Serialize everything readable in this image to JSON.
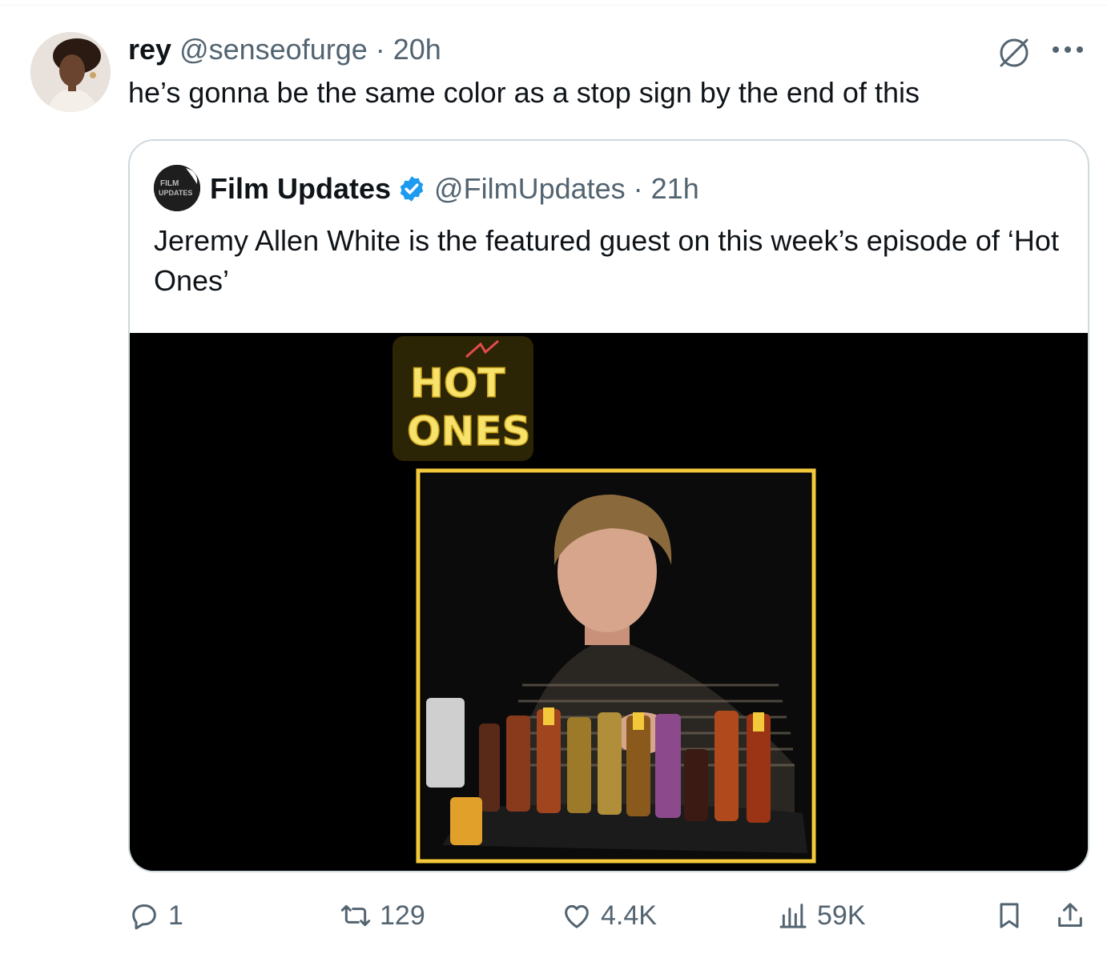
{
  "tweet": {
    "display_name": "rey",
    "handle": "@senseofurge",
    "separator": "·",
    "time": "20h",
    "text": "he’s gonna be the same color as a stop sign by the end of this",
    "avatar_icon": "user-avatar",
    "header_icons": [
      "no-entry-icon",
      "more-options-icon"
    ]
  },
  "quoted": {
    "display_name": "Film Updates",
    "handle": "@FilmUpdates",
    "separator": "·",
    "time": "21h",
    "text": "Jeremy Allen White is the featured guest on this week’s episode of ‘Hot Ones’",
    "avatar_logo_text": "FILM UPDATES",
    "verified": true,
    "verified_color": "#1d9bf0",
    "media": {
      "description_icon": "video-still",
      "logo_text_line1": "HOT",
      "logo_text_line2": "ONES",
      "frame_color": "#f3c83b",
      "background": "#000000"
    }
  },
  "actions": {
    "replies": "1",
    "retweets": "129",
    "likes": "4.4K",
    "views": "59K",
    "icons": [
      "reply-icon",
      "retweet-icon",
      "like-icon",
      "views-icon",
      "bookmark-icon",
      "share-icon"
    ],
    "color": "#536471"
  }
}
